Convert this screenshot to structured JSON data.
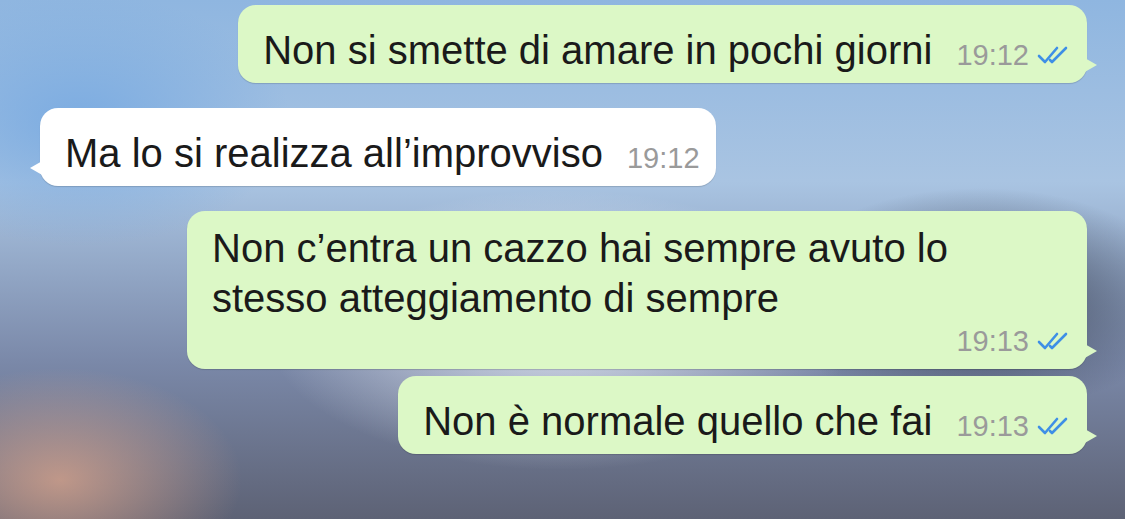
{
  "messages": [
    {
      "text": "Non si smette di amare in pochi giorni",
      "time": "19:12",
      "outgoing": true,
      "read": true
    },
    {
      "text": "Ma lo si realizza all’improvviso",
      "time": "19:12",
      "outgoing": false,
      "read": false
    },
    {
      "text": "Non c’entra un cazzo hai sempre avuto lo stesso atteggiamento di sempre",
      "time": "19:13",
      "outgoing": true,
      "read": true
    },
    {
      "text": "Non è normale quello che fai",
      "time": "19:13",
      "outgoing": true,
      "read": true
    }
  ]
}
